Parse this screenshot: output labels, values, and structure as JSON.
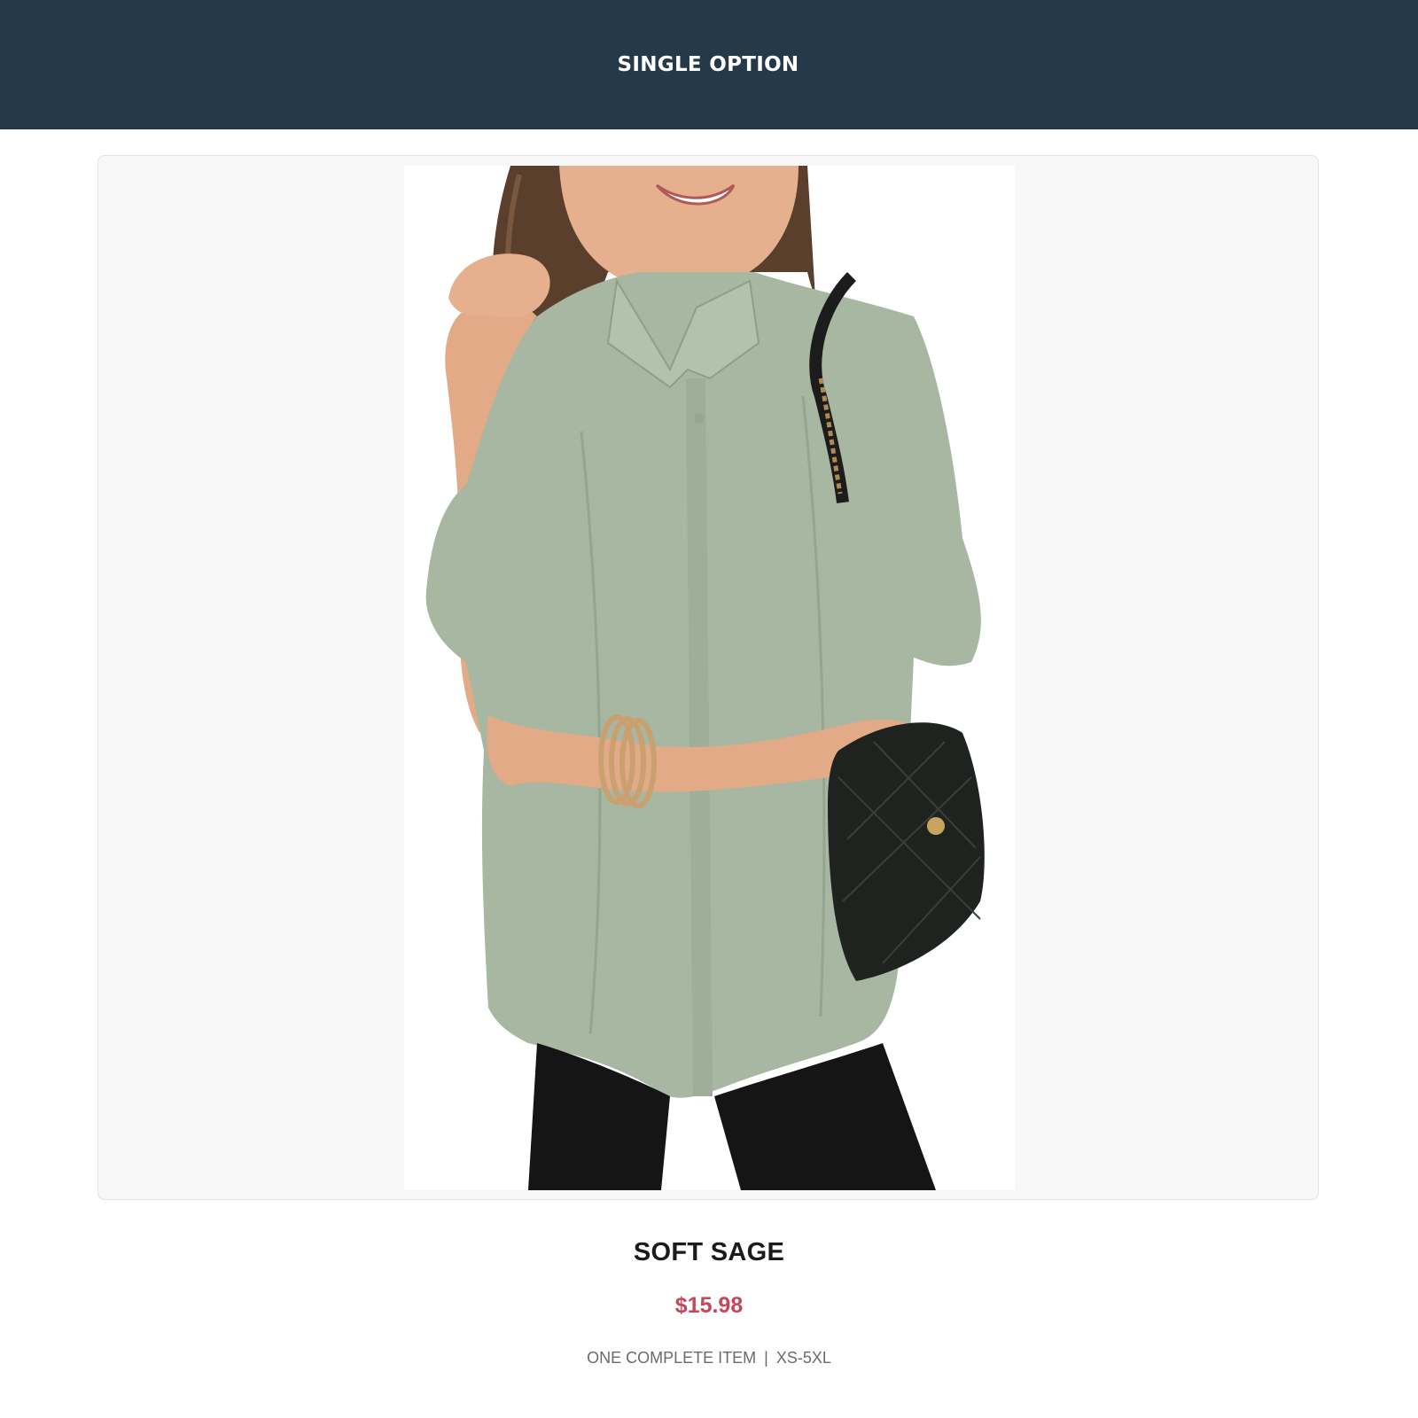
{
  "header": {
    "title": "SINGLE OPTION"
  },
  "product": {
    "image_alt": "Woman wearing a soft sage short-sleeve button-up shirt with black leggings and a quilted black crossbody bag",
    "name": "SOFT SAGE",
    "price": "$15.98",
    "detail": "ONE COMPLETE ITEM",
    "separator": "|",
    "sizes": "XS-5XL"
  },
  "colors": {
    "header_bg": "#253949",
    "price": "#c4475c",
    "shirt": "#a7b7a1"
  }
}
